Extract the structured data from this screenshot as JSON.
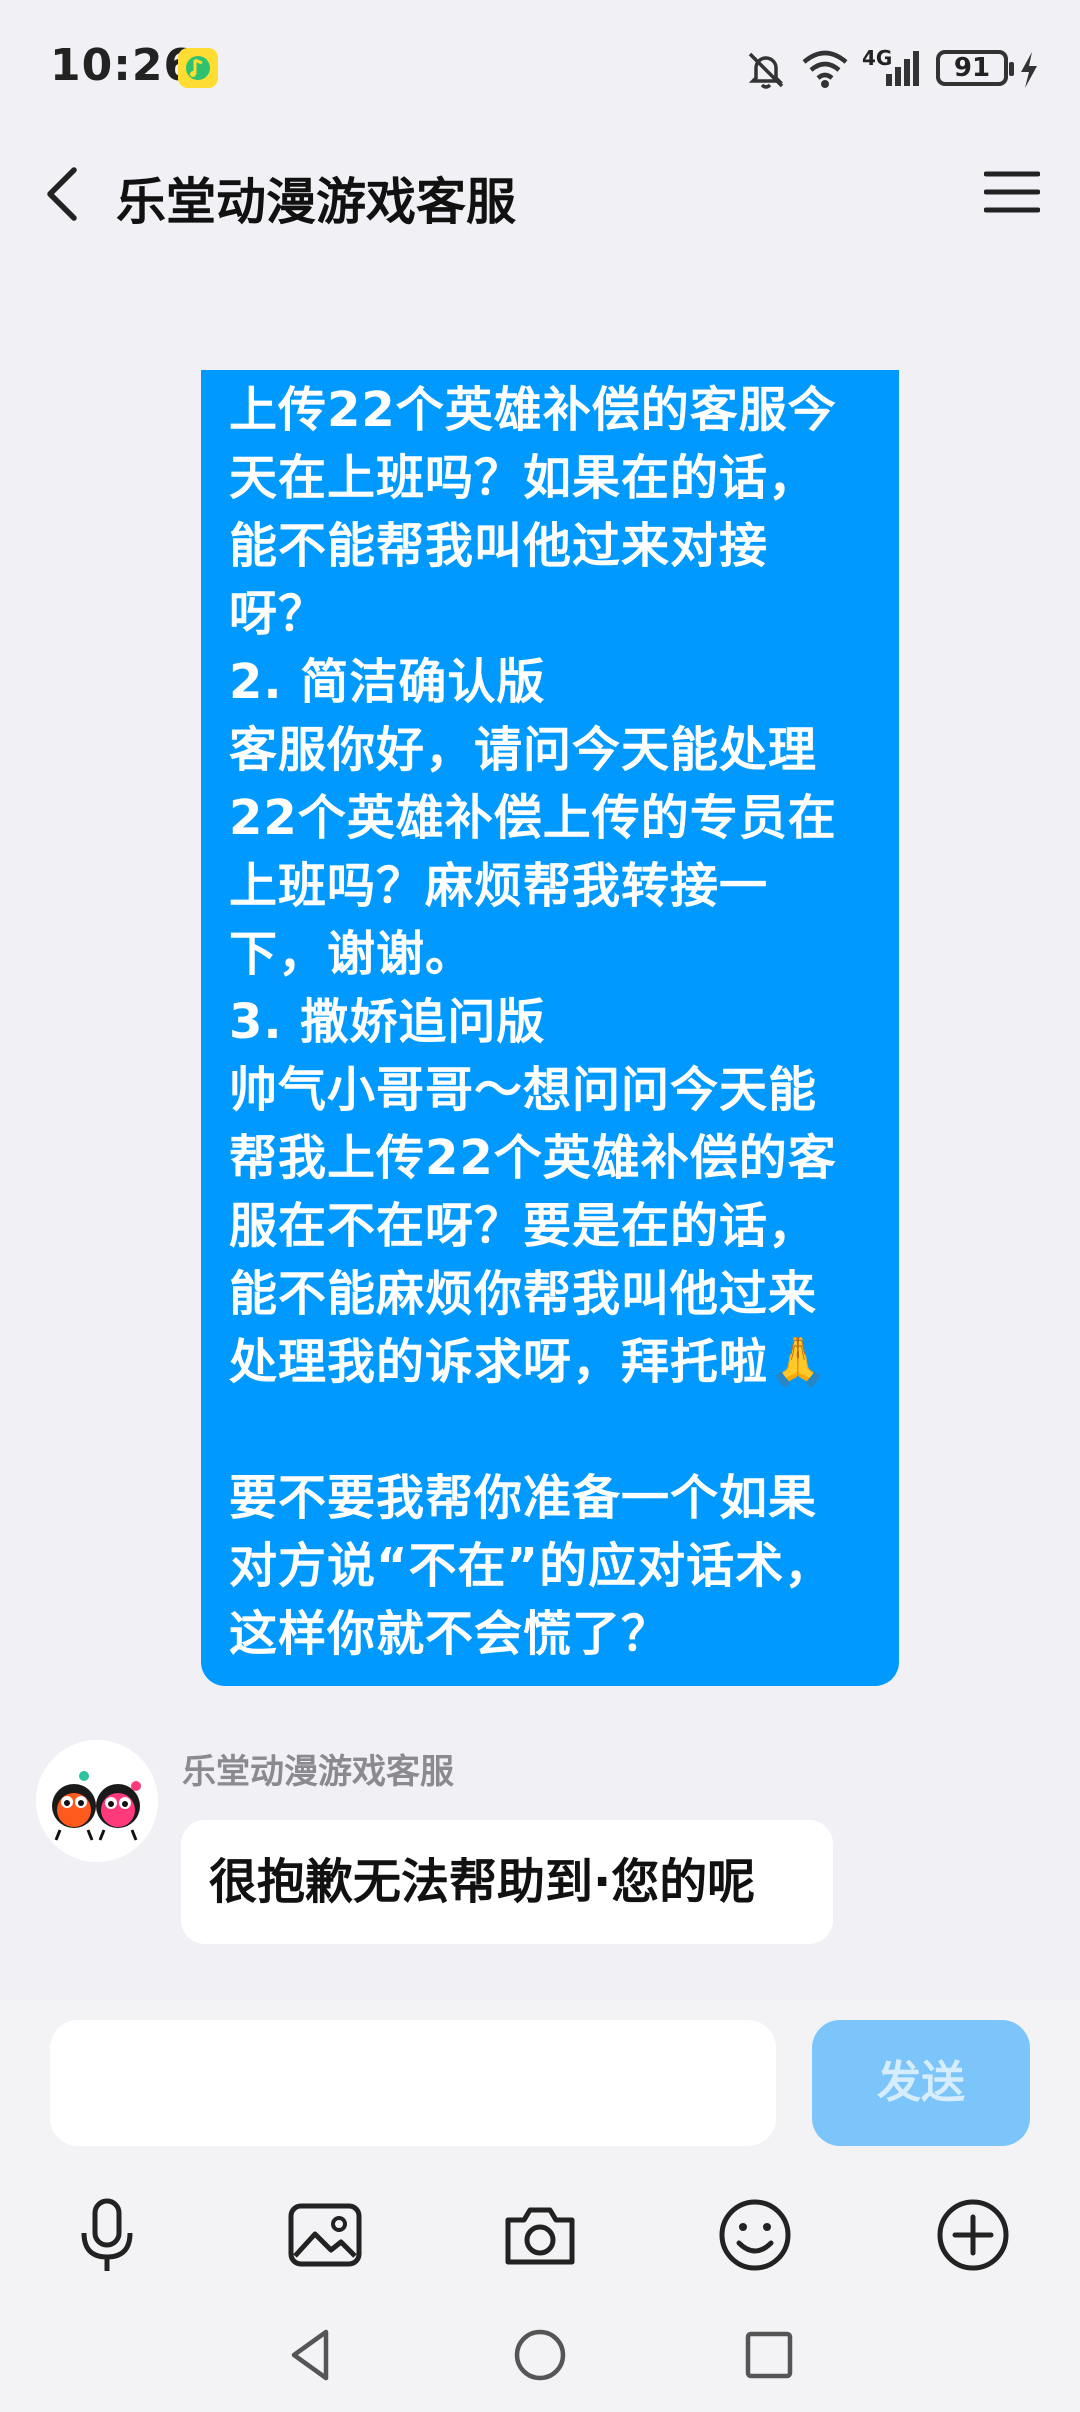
{
  "status_bar": {
    "time": "10:26",
    "network": "4G",
    "battery": "91"
  },
  "header": {
    "title": "乐堂动漫游戏客服"
  },
  "messages": {
    "outgoing": {
      "text": "上传22个英雄补偿的客服今\n天在上班吗？如果在的话，\n能不能帮我叫他过来对接\n呀？\n2. 简洁确认版\n客服你好，请问今天能处理\n22个英雄补偿上传的专员在\n上班吗？麻烦帮我转接一\n下，谢谢。\n3. 撒娇追问版\n帅气小哥哥～想问问今天能\n帮我上传22个英雄补偿的客\n服在不在呀？要是在的话，\n能不能麻烦你帮我叫他过来\n处理我的诉求呀，拜托啦🙏\n\n要不要我帮你准备一个如果\n对方说“不在”的应对话术，\n这样你就不会慌了？"
    },
    "incoming": {
      "sender": "乐堂动漫游戏客服",
      "text": "很抱歉无法帮助到·您的呢"
    }
  },
  "input": {
    "value": "",
    "placeholder": "",
    "send_label": "发送"
  },
  "colors": {
    "outgoing_bubble": "#0099ff",
    "send_button": "#7cc5fb",
    "background": "#f1f1f5"
  },
  "icons": {
    "toolbar": [
      "microphone-icon",
      "image-icon",
      "camera-icon",
      "emoji-icon",
      "plus-icon"
    ],
    "nav": [
      "back-triangle-icon",
      "home-circle-icon",
      "recents-square-icon"
    ]
  }
}
